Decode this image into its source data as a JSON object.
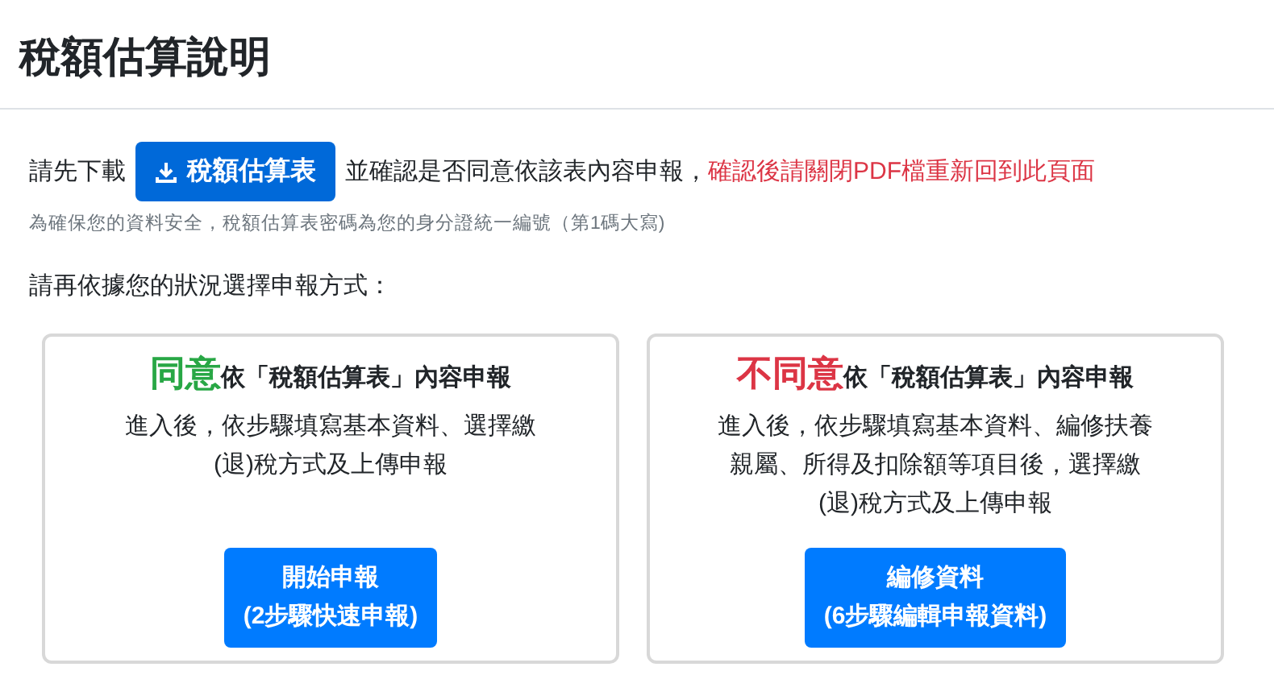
{
  "title": "稅額估算說明",
  "download_line": {
    "before": "請先下載",
    "button": "稅額估算表",
    "after": "並確認是否同意依該表內容申報，",
    "warning": "確認後請關閉PDF檔重新回到此頁面"
  },
  "note": "為確保您的資料安全，稅額估算表密碼為您的身分證統一編號（第1碼大寫)",
  "prompt": "請再依據您的狀況選擇申報方式：",
  "cards": [
    {
      "emphasis": "同意",
      "heading": "依「稅額估算表」內容申報",
      "color": "#28a745",
      "description": [
        "進入後，依步驟填寫基本資料、選擇繳",
        "(退)稅方式及上傳申報"
      ],
      "button": [
        "開始申報",
        "(2步驟快速申報)"
      ]
    },
    {
      "emphasis": "不同意",
      "heading": "依「稅額估算表」內容申報",
      "color": "#dc3545",
      "description": [
        "進入後，依步驟填寫基本資料、編修扶養",
        "親屬、所得及扣除額等項目後，選擇繳",
        "(退)稅方式及上傳申報"
      ],
      "button": [
        "編修資料",
        "(6步驟編輯申報資料)"
      ]
    }
  ]
}
